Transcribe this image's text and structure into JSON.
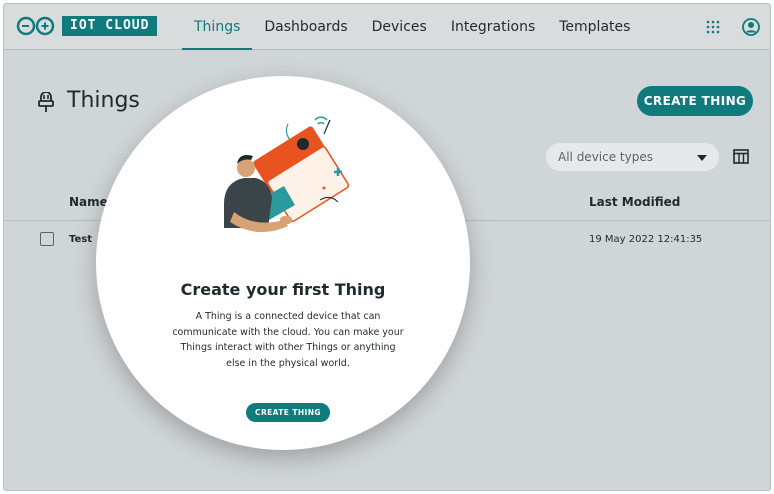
{
  "brand": {
    "name": "IOT CLOUD",
    "color": "#0f7b7d"
  },
  "nav": {
    "items": [
      {
        "label": "Things",
        "active": true
      },
      {
        "label": "Dashboards",
        "active": false
      },
      {
        "label": "Devices",
        "active": false
      },
      {
        "label": "Integrations",
        "active": false
      },
      {
        "label": "Templates",
        "active": false
      }
    ],
    "icons": [
      "apps-grid-icon",
      "account-icon"
    ]
  },
  "page": {
    "title": "Things",
    "title_icon": "thing-plug-icon",
    "create_button": "CREATE THING",
    "filter": {
      "selected": "All device types"
    },
    "columns_icon": "columns-icon"
  },
  "table": {
    "headers": [
      "Name",
      "Last Modified"
    ],
    "rows": [
      {
        "name": "Test",
        "last_modified": "19 May 2022 12:41:35",
        "checked": false
      }
    ]
  },
  "onboarding": {
    "title": "Create your first Thing",
    "description": "A Thing is a connected device that can communicate with the cloud. You can make your Things interact with other Things or anything else in the physical world.",
    "button": "CREATE THING",
    "illustration": "person-holding-device-illustration"
  }
}
